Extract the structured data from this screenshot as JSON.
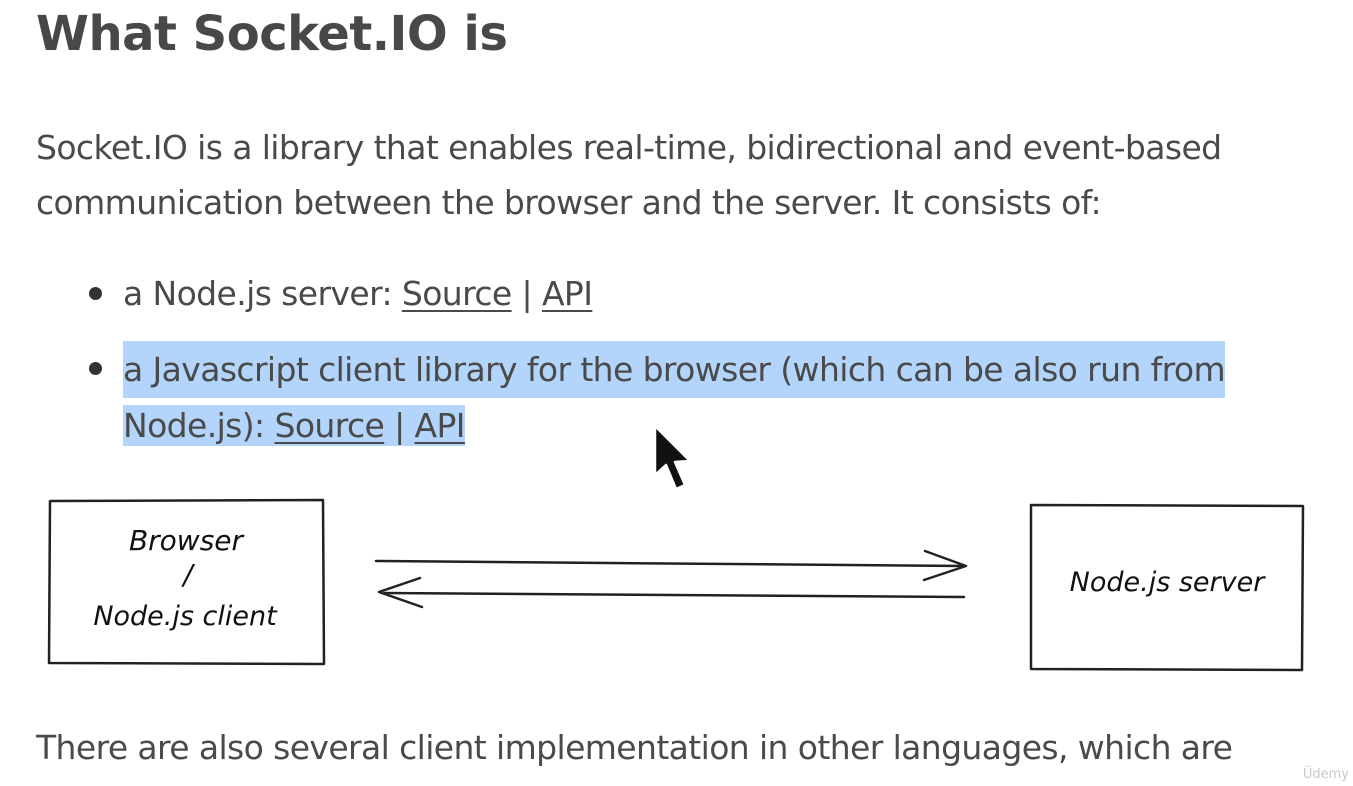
{
  "heading": "What Socket.IO is",
  "intro": {
    "line1": "Socket.IO is a library that enables real-time, bidirectional and event-based",
    "line2": "communication between the browser and the server. It consists of:"
  },
  "list": [
    {
      "text": "a Node.js server: ",
      "source_label": "Source",
      "separator": " | ",
      "api_label": "API"
    },
    {
      "text_line1": "a Javascript client library for the browser (which can be also run from",
      "text_line2": "Node.js): ",
      "source_label": "Source",
      "separator": " | ",
      "api_label": "API",
      "selected": true
    }
  ],
  "diagram": {
    "left_box": {
      "line1": "Browser",
      "line2": "/",
      "line3": "Node.js client"
    },
    "right_box": {
      "label": "Node.js server"
    }
  },
  "closing": "There are also several client implementation in other languages, which are",
  "watermark": "Üdemy",
  "colors": {
    "selection": "#b3d4fb",
    "text": "#4a4a4a",
    "heading": "#484848"
  },
  "icons": {
    "cursor": "arrow-pointer-icon",
    "bullet": "bullet-dot-icon",
    "arrow": "double-arrow"
  }
}
